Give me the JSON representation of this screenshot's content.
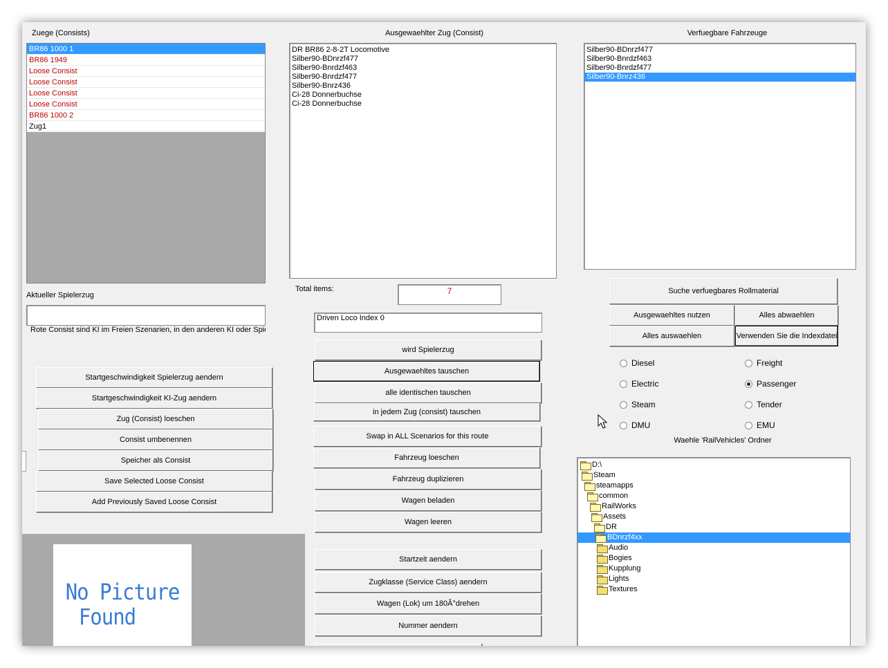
{
  "consists": {
    "title": "Zuege (Consists)",
    "items": [
      {
        "label": "BR86 1000 1",
        "red": false,
        "selected": true
      },
      {
        "label": "BR86 1949",
        "red": true,
        "selected": false
      },
      {
        "label": "Loose Consist",
        "red": true,
        "selected": false
      },
      {
        "label": "Loose Consist",
        "red": true,
        "selected": false
      },
      {
        "label": "Loose Consist",
        "red": true,
        "selected": false
      },
      {
        "label": "Loose Consist",
        "red": true,
        "selected": false
      },
      {
        "label": "BR86 1000 2",
        "red": true,
        "selected": false
      },
      {
        "label": "Zug1",
        "red": false,
        "selected": false
      }
    ]
  },
  "player": {
    "label": "Aktueller Spielerzug",
    "value": "",
    "note": "Rote Consist sind KI im Freien Szenarien, in den anderen KI oder Spieler"
  },
  "left_buttons": [
    "Startgeschwindigkeit Spielerzug aendern",
    "Startgeschwindigkeit KI-Zug aendern",
    "Zug (Consist) loeschen",
    "Consist umbenennen",
    "Speicher als Consist",
    "Save Selected Loose Consist",
    "Add Previously Saved Loose Consist"
  ],
  "preview": {
    "line1": "No Picture",
    "line2": "Found"
  },
  "selected_consist": {
    "title": "Ausgewaehlter Zug (Consist)",
    "items": [
      "DR BR86 2-8-2T Locomotive",
      "Silber90-BDnrzf477",
      "Silber90-Bnrdzf463",
      "Silber90-Bnrdzf477",
      "Silber90-Bnrz436",
      "Ci-28 Donnerbuchse",
      "Ci-28 Donnerbuchse"
    ],
    "total_label": "Total items:",
    "total_value": "7",
    "driven_loco": "Driven Loco Index 0"
  },
  "middle_buttons": [
    "wird Spielerzug",
    "Ausgewaehltes tauschen",
    "alle identischen tauschen",
    "in jedem Zug (consist) tauschen",
    "Swap in ALL Scenarios for this route",
    "Fahrzeug loeschen",
    "Fahrzeug duplizieren",
    "Wagen beladen",
    "Wagen leeren",
    "Startzeit aendern",
    "Zugklasse (Service Class) aendern",
    "Wagen (Lok) um 180Â°drehen",
    "Nummer aendern"
  ],
  "available": {
    "title": "Verfuegbare Fahrzeuge",
    "items": [
      {
        "label": "Silber90-BDnrzf477",
        "selected": false
      },
      {
        "label": "Silber90-Bnrdzf463",
        "selected": false
      },
      {
        "label": "Silber90-Bnrdzf477",
        "selected": false
      },
      {
        "label": "Silber90-Bnrz436",
        "selected": true
      }
    ]
  },
  "right_buttons": {
    "search": "Suche verfuegbares Rollmaterial",
    "use_selected": "Ausgewaehltes nutzen",
    "deselect_all": "Alles abwaehlen",
    "select_all": "Alles auswaehlen",
    "use_index": "Verwenden Sie die Indexdatei"
  },
  "filters": {
    "diesel": {
      "label": "Diesel",
      "checked": false
    },
    "electric": {
      "label": "Electric",
      "checked": false
    },
    "steam": {
      "label": "Steam",
      "checked": false
    },
    "dmu": {
      "label": "DMU",
      "checked": false
    },
    "freight": {
      "label": "Freight",
      "checked": false
    },
    "passenger": {
      "label": "Passenger",
      "checked": true
    },
    "tender": {
      "label": "Tender",
      "checked": false
    },
    "emu": {
      "label": "EMU",
      "checked": false
    }
  },
  "folder_picker": {
    "title": "Waehle 'RailVehicles' Ordner",
    "tree": [
      {
        "label": "D:\\",
        "selected": false
      },
      {
        "label": "Steam",
        "selected": false
      },
      {
        "label": "steamapps",
        "selected": false
      },
      {
        "label": "common",
        "selected": false
      },
      {
        "label": "RailWorks",
        "selected": false
      },
      {
        "label": "Assets",
        "selected": false
      },
      {
        "label": "DR",
        "selected": false
      },
      {
        "label": "BDnrzf4xx",
        "selected": true
      },
      {
        "label": "Audio",
        "selected": false
      },
      {
        "label": "Bogies",
        "selected": false
      },
      {
        "label": "Kupplung",
        "selected": false
      },
      {
        "label": "Lights",
        "selected": false
      },
      {
        "label": "Textures",
        "selected": false
      }
    ]
  },
  "colors": {
    "selection": "#3399ff",
    "red_consist": "#c00000",
    "panel": "#f0f0f0",
    "no_picture_text": "#3a7bd5"
  }
}
